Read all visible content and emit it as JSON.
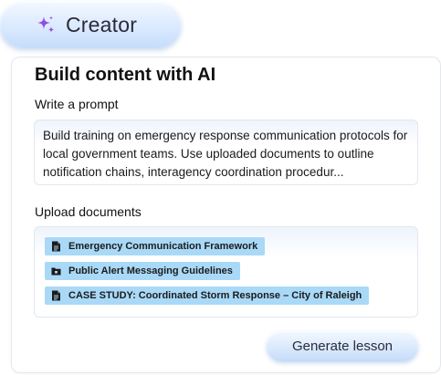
{
  "header": {
    "icon": "sparkle-icon",
    "title": "Creator"
  },
  "card": {
    "title": "Build content with AI",
    "prompt_label": "Write a prompt",
    "prompt_text": "Build training on emergency response communication protocols for local government teams. Use uploaded documents to outline notification chains, interagency coordination procedur...",
    "upload_label": "Upload documents",
    "documents": [
      {
        "name": "Emergency Communication Framework",
        "icon": "document-icon"
      },
      {
        "name": "Public Alert Messaging Guidelines",
        "icon": "folder-icon"
      },
      {
        "name": "CASE STUDY: Coordinated Storm Response – City of Raleigh",
        "icon": "document-icon"
      }
    ],
    "generate_label": "Generate lesson"
  },
  "colors": {
    "accent_purple": "#7b3fe4",
    "chip_blue": "#a9d9f7",
    "pill_blue": "#d8e8fd"
  }
}
